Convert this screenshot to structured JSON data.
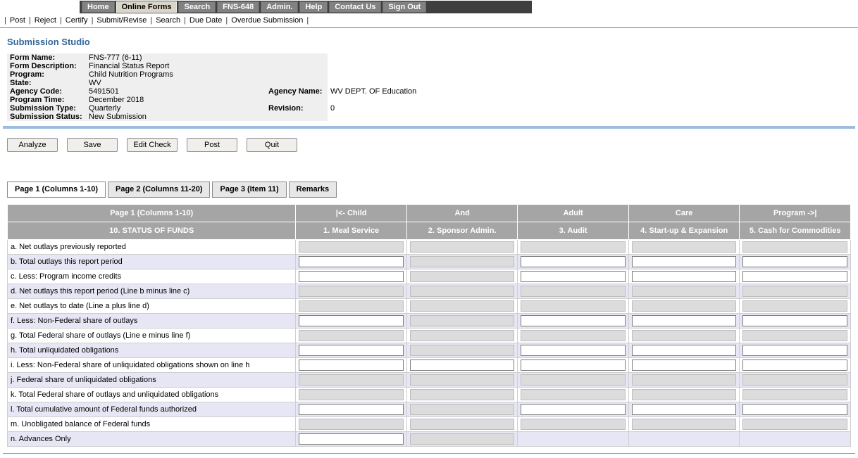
{
  "colors": {
    "nav_bar": "#3f3f3f",
    "nav_active_bg": "#d9d5c7",
    "heading": "#336699",
    "divider": "#9cbce2",
    "table_header": "#a5a5a5",
    "row_alt": "#e6e6f5",
    "readonly_bg": "#dcdcdc"
  },
  "nav": {
    "items": [
      {
        "label": "Home",
        "active": false
      },
      {
        "label": "Online Forms",
        "active": true
      },
      {
        "label": "Search",
        "active": false
      },
      {
        "label": "FNS-648",
        "active": false
      },
      {
        "label": "Admin.",
        "active": false
      },
      {
        "label": "Help",
        "active": false
      },
      {
        "label": "Contact Us",
        "active": false
      },
      {
        "label": "Sign Out",
        "active": false
      }
    ]
  },
  "menubar": {
    "items": [
      "Post",
      "Reject",
      "Certify",
      "Submit/Revise",
      "Search",
      "Due Date",
      "Overdue Submission"
    ],
    "separator": "|"
  },
  "page": {
    "title": "Submission Studio"
  },
  "form_info": {
    "rows": [
      {
        "label1": "Form Name:",
        "value1": "FNS-777 (6-11)",
        "label2": "",
        "value2": ""
      },
      {
        "label1": "Form Description:",
        "value1": "Financial Status Report",
        "label2": "",
        "value2": ""
      },
      {
        "label1": "Program:",
        "value1": "Child Nutrition Programs",
        "label2": "",
        "value2": ""
      },
      {
        "label1": "State:",
        "value1": "WV",
        "label2": "",
        "value2": ""
      },
      {
        "label1": "Agency Code:",
        "value1": "5491501",
        "label2": "Agency Name:",
        "value2": "WV DEPT. OF Education"
      },
      {
        "label1": "Program Time:",
        "value1": "December 2018",
        "label2": "",
        "value2": ""
      },
      {
        "label1": "Submission Type:",
        "value1": "Quarterly",
        "label2": "Revision:",
        "value2": "0"
      },
      {
        "label1": "Submission Status:",
        "value1": "New Submission",
        "label2": "",
        "value2": ""
      }
    ]
  },
  "toolbar": {
    "buttons": [
      "Analyze",
      "Save",
      "Edit Check",
      "Post",
      "Quit"
    ]
  },
  "tabs": [
    {
      "label": "Page 1 (Columns 1-10)",
      "active": true
    },
    {
      "label": "Page 2 (Columns 11-20)",
      "active": false
    },
    {
      "label": "Page 3 (Item 11)",
      "active": false
    },
    {
      "label": "Remarks",
      "active": false
    }
  ],
  "grid": {
    "header_row1": [
      "Page 1 (Columns 1-10)",
      "|<- Child",
      "And",
      "Adult",
      "Care",
      "Program ->|"
    ],
    "header_row2": [
      "10. STATUS OF FUNDS",
      "1. Meal Service",
      "2. Sponsor Admin.",
      "3. Audit",
      "4. Start-up & Expansion",
      "5. Cash for Commodities"
    ],
    "rows": [
      {
        "label": "a. Net outlays previously reported",
        "cells": [
          {
            "state": "readonly",
            "value": ""
          },
          {
            "state": "readonly",
            "value": ""
          },
          {
            "state": "readonly",
            "value": ""
          },
          {
            "state": "readonly",
            "value": ""
          },
          {
            "state": "readonly",
            "value": ""
          }
        ]
      },
      {
        "label": "b. Total outlays this report period",
        "cells": [
          {
            "state": "input",
            "value": ""
          },
          {
            "state": "readonly",
            "value": ""
          },
          {
            "state": "input",
            "value": ""
          },
          {
            "state": "input",
            "value": ""
          },
          {
            "state": "input",
            "value": ""
          }
        ]
      },
      {
        "label": "c. Less: Program income credits",
        "cells": [
          {
            "state": "input",
            "value": ""
          },
          {
            "state": "readonly",
            "value": ""
          },
          {
            "state": "input",
            "value": ""
          },
          {
            "state": "input",
            "value": ""
          },
          {
            "state": "input",
            "value": ""
          }
        ]
      },
      {
        "label": "d. Net outlays this report period (Line b minus line c)",
        "cells": [
          {
            "state": "readonly",
            "value": ""
          },
          {
            "state": "readonly",
            "value": ""
          },
          {
            "state": "readonly",
            "value": ""
          },
          {
            "state": "readonly",
            "value": ""
          },
          {
            "state": "readonly",
            "value": ""
          }
        ]
      },
      {
        "label": "e. Net outlays to date (Line a plus line d)",
        "cells": [
          {
            "state": "readonly",
            "value": ""
          },
          {
            "state": "readonly",
            "value": ""
          },
          {
            "state": "readonly",
            "value": ""
          },
          {
            "state": "readonly",
            "value": ""
          },
          {
            "state": "readonly",
            "value": ""
          }
        ]
      },
      {
        "label": "f. Less: Non-Federal share of outlays",
        "cells": [
          {
            "state": "input",
            "value": ""
          },
          {
            "state": "readonly",
            "value": ""
          },
          {
            "state": "input",
            "value": ""
          },
          {
            "state": "input",
            "value": ""
          },
          {
            "state": "input",
            "value": ""
          }
        ]
      },
      {
        "label": "g. Total Federal share of outlays (Line e minus line f)",
        "cells": [
          {
            "state": "readonly",
            "value": ""
          },
          {
            "state": "readonly",
            "value": ""
          },
          {
            "state": "readonly",
            "value": ""
          },
          {
            "state": "readonly",
            "value": ""
          },
          {
            "state": "readonly",
            "value": ""
          }
        ]
      },
      {
        "label": "h. Total unliquidated obligations",
        "cells": [
          {
            "state": "input",
            "value": ""
          },
          {
            "state": "readonly",
            "value": ""
          },
          {
            "state": "input",
            "value": ""
          },
          {
            "state": "input",
            "value": ""
          },
          {
            "state": "input",
            "value": ""
          }
        ]
      },
      {
        "label": "i. Less: Non-Federal share of unliquidated obligations shown on line h",
        "cells": [
          {
            "state": "input",
            "value": ""
          },
          {
            "state": "input",
            "value": ""
          },
          {
            "state": "input",
            "value": ""
          },
          {
            "state": "input",
            "value": ""
          },
          {
            "state": "input",
            "value": ""
          }
        ]
      },
      {
        "label": "j. Federal share of unliquidated obligations",
        "cells": [
          {
            "state": "readonly",
            "value": ""
          },
          {
            "state": "readonly",
            "value": ""
          },
          {
            "state": "readonly",
            "value": ""
          },
          {
            "state": "readonly",
            "value": ""
          },
          {
            "state": "readonly",
            "value": ""
          }
        ]
      },
      {
        "label": "k. Total Federal share of outlays and unliquidated obligations",
        "cells": [
          {
            "state": "readonly",
            "value": ""
          },
          {
            "state": "readonly",
            "value": ""
          },
          {
            "state": "readonly",
            "value": ""
          },
          {
            "state": "readonly",
            "value": ""
          },
          {
            "state": "readonly",
            "value": ""
          }
        ]
      },
      {
        "label": "l. Total cumulative amount of Federal funds authorized",
        "cells": [
          {
            "state": "input",
            "value": ""
          },
          {
            "state": "readonly",
            "value": ""
          },
          {
            "state": "input",
            "value": ""
          },
          {
            "state": "input",
            "value": ""
          },
          {
            "state": "input",
            "value": ""
          }
        ]
      },
      {
        "label": "m. Unobligated balance of Federal funds",
        "cells": [
          {
            "state": "readonly",
            "value": ""
          },
          {
            "state": "readonly",
            "value": ""
          },
          {
            "state": "readonly",
            "value": ""
          },
          {
            "state": "readonly",
            "value": ""
          },
          {
            "state": "readonly",
            "value": ""
          }
        ]
      },
      {
        "label": "n. Advances Only",
        "cells": [
          {
            "state": "input",
            "value": ""
          },
          {
            "state": "readonly",
            "value": ""
          },
          {
            "state": "none",
            "value": ""
          },
          {
            "state": "none",
            "value": ""
          },
          {
            "state": "none",
            "value": ""
          }
        ]
      }
    ]
  }
}
